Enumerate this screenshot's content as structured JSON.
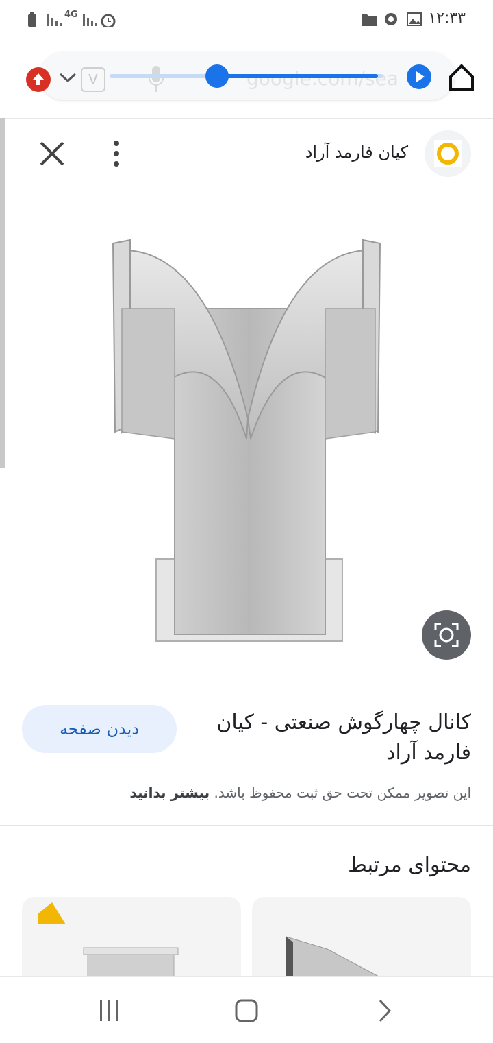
{
  "status_bar": {
    "time": "۱۲:۳۳",
    "network": "4G"
  },
  "browser": {
    "url": "google.com/sea",
    "v_badge": "V"
  },
  "viewer": {
    "site_name": "کیان فارمد آراد",
    "title": "کانال چهارگوش صنعتی - کیان فارمد آراد",
    "visit_button": "دیدن صفحه",
    "copyright_text": "این تصویر ممکن تحت حق ثبت محفوظ باشد.",
    "learn_more": "بیشتر بدانید"
  },
  "related": {
    "heading": "محتوای مرتبط"
  },
  "colors": {
    "accent": "#1a73e8",
    "button_bg": "#e8f0fe",
    "lens_bg": "#5f6368"
  }
}
